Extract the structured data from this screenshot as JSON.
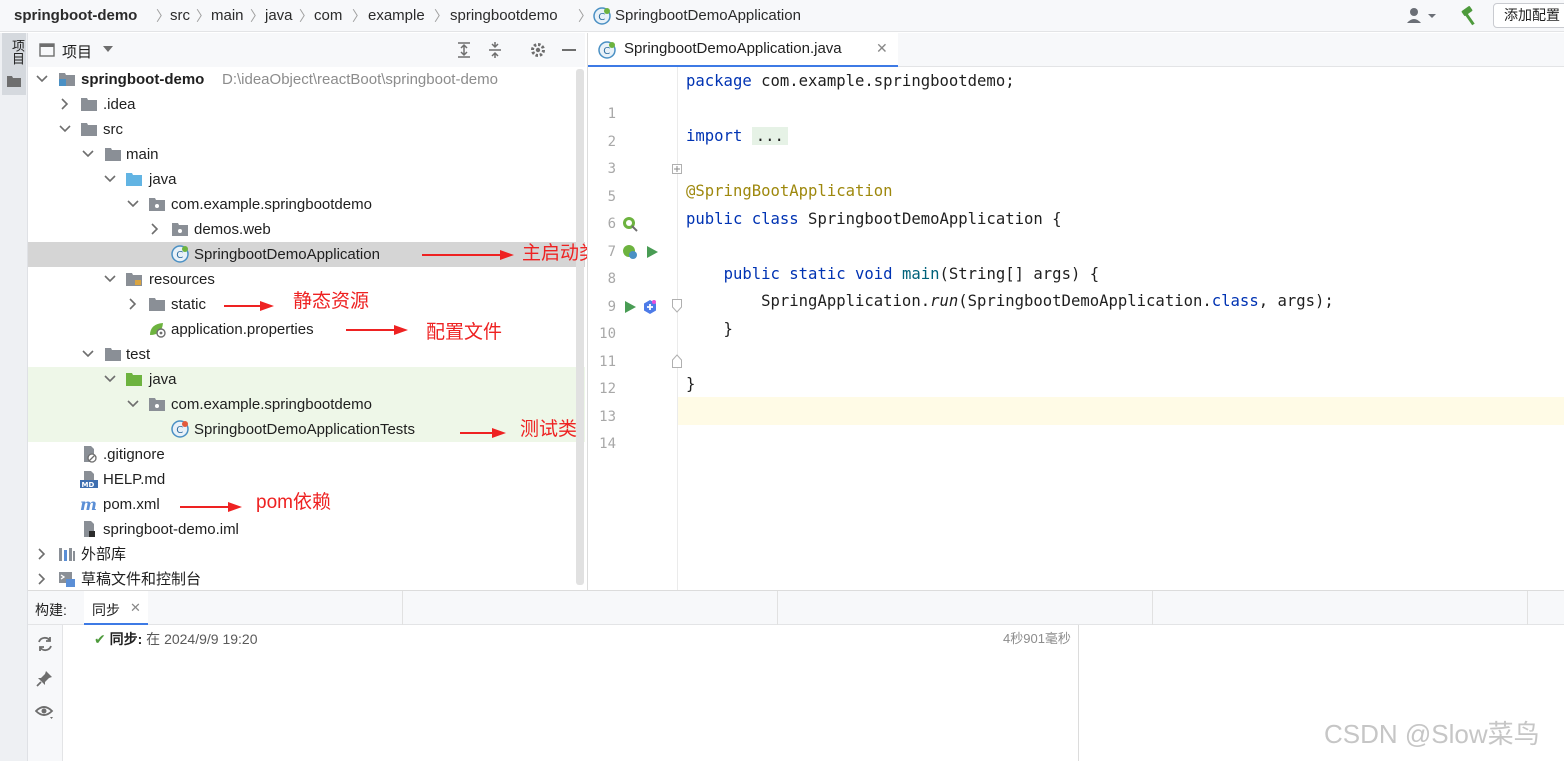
{
  "breadcrumb": {
    "items": [
      "springboot-demo",
      "src",
      "main",
      "java",
      "com",
      "example",
      "springbootdemo",
      "SpringbootDemoApplication"
    ],
    "separator": "〉"
  },
  "toolbar": {
    "add_config_label": "添加配置"
  },
  "left_strip": {
    "project_tab_label": "项目"
  },
  "project_panel": {
    "title": "项目",
    "tree": [
      {
        "label": "springboot-demo",
        "path": "D:\\ideaObject\\reactBoot\\springboot-demo"
      },
      {
        "label": ".idea"
      },
      {
        "label": "src"
      },
      {
        "label": "main"
      },
      {
        "label": "java"
      },
      {
        "label": "com.example.springbootdemo"
      },
      {
        "label": "demos.web"
      },
      {
        "label": "SpringbootDemoApplication"
      },
      {
        "label": "resources"
      },
      {
        "label": "static"
      },
      {
        "label": "application.properties"
      },
      {
        "label": "test"
      },
      {
        "label": "java"
      },
      {
        "label": "com.example.springbootdemo"
      },
      {
        "label": "SpringbootDemoApplicationTests"
      },
      {
        "label": ".gitignore"
      },
      {
        "label": "HELP.md"
      },
      {
        "label": "pom.xml"
      },
      {
        "label": "springboot-demo.iml"
      },
      {
        "label": "外部库"
      },
      {
        "label": "草稿文件和控制台"
      }
    ]
  },
  "annotations": {
    "main_class": "主启动类",
    "static_resources": "静态资源",
    "config_file": "配置文件",
    "test_class": "测试类",
    "pom_dependency": "pom依赖"
  },
  "editor": {
    "tab_label": "SpringbootDemoApplication.java",
    "line_numbers": [
      "1",
      "2",
      "3",
      "5",
      "6",
      "7",
      "8",
      "9",
      "10",
      "11",
      "12",
      "13",
      "14"
    ],
    "code": {
      "l1_kw": "package",
      "l1_rest": " com.example.springbootdemo;",
      "l3_kw": "import",
      "l3_fold": "...",
      "l6_annotation": "@SpringBootApplication",
      "l7_kw": "public class",
      "l7_rest": " SpringbootDemoApplication {",
      "l9_indent": "    ",
      "l9_kw": "public static void",
      "l9_fn": " main",
      "l9_rest": "(String[] args) {",
      "l10_indent": "        ",
      "l10_pre": "SpringApplication.",
      "l10_fn": "run",
      "l10_mid": "(SpringbootDemoApplication.",
      "l10_kw": "class",
      "l10_post": ", args);",
      "l11": "    }",
      "l13": "}"
    }
  },
  "build_panel": {
    "label": "构建:",
    "tab_label": "同步",
    "sync_prefix": "同步:",
    "sync_text": " 在 2024/9/9 19:20",
    "sync_duration": "4秒901毫秒"
  },
  "watermark": "CSDN @Slow菜鸟",
  "colors": {
    "keyword": "#0033b3",
    "annotation": "#9e880d",
    "method": "#00627a",
    "annotation_red": "#ee2222",
    "selection": "#d5d5d5",
    "test_bg": "#eef7e8"
  }
}
